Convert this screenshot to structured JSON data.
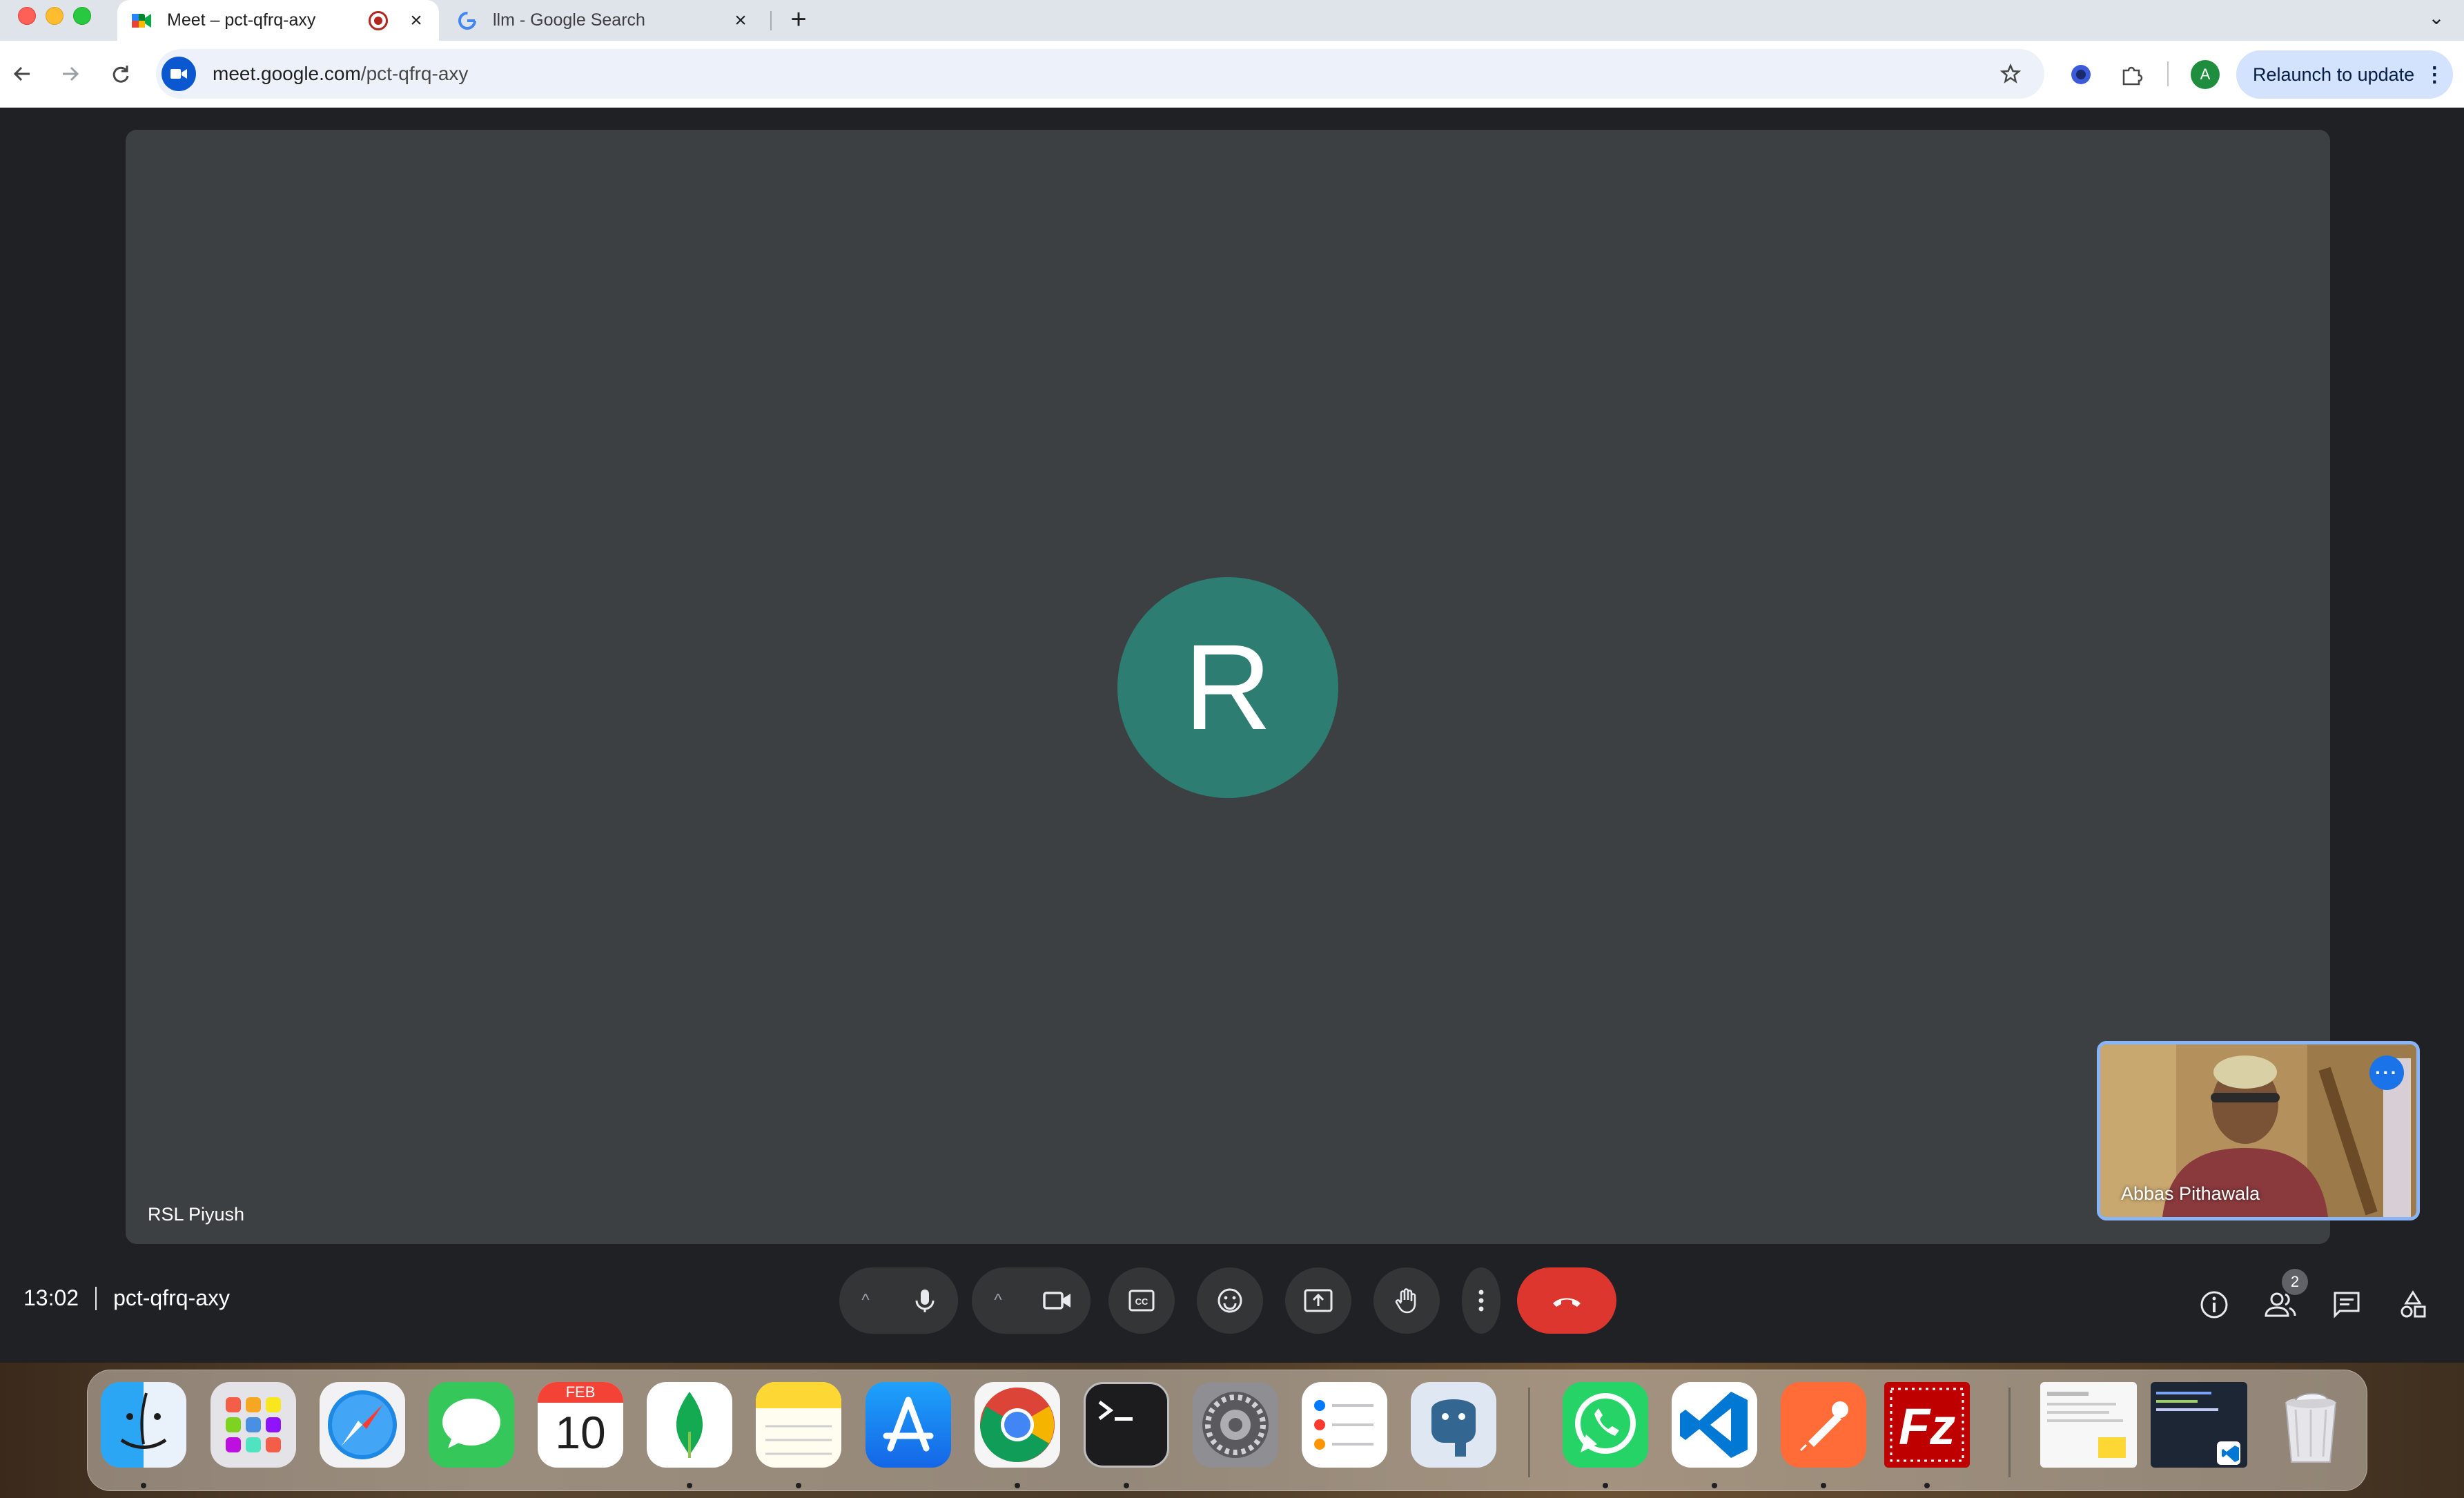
{
  "browser": {
    "tabs": [
      {
        "title": "Meet – pct-qfrq-axy",
        "favicon": "google-meet-icon",
        "active": true,
        "recording": true
      },
      {
        "title": "llm - Google Search",
        "favicon": "google-icon",
        "active": false
      }
    ],
    "url_host": "meet.google.com",
    "url_path": "/pct-qfrq-axy",
    "profile_initial": "A",
    "relaunch_label": "Relaunch to update"
  },
  "meet": {
    "main_participant": {
      "initial": "R",
      "name": "RSL Piyush",
      "avatar_color": "#2d7d72"
    },
    "self_view": {
      "name": "Abbas Pithawala"
    },
    "clock": "13:02",
    "meeting_code": "pct-qfrq-axy",
    "participant_count": "2"
  },
  "calendar": {
    "month": "FEB",
    "day": "10"
  },
  "dock": {
    "apps": [
      "Finder",
      "Launchpad",
      "Safari",
      "Messages",
      "Calendar",
      "MongoDB Compass",
      "Notes",
      "App Store",
      "Google Chrome",
      "Terminal",
      "System Settings",
      "Reminders",
      "pgAdmin",
      "WhatsApp",
      "Visual Studio Code",
      "Postman",
      "FileZilla",
      "Preview",
      "Finder Window",
      "Trash"
    ]
  },
  "colors": {
    "accent": "#1a73e8",
    "end_call": "#dc362e",
    "tile_bg": "#3c4043",
    "page_bg": "#202124"
  }
}
